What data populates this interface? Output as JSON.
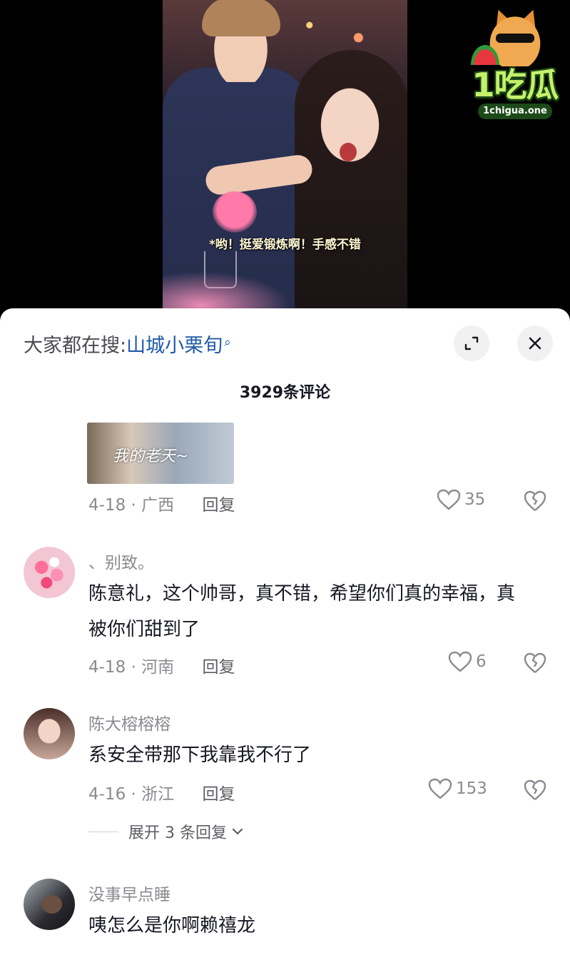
{
  "video": {
    "subtitle": "*哟！挺爱锻炼啊！手感不错"
  },
  "watermark": {
    "logo_text": "1吃瓜",
    "domain": "1chigua.one"
  },
  "search": {
    "prefix": "大家都在搜:",
    "term": "山城小栗旬"
  },
  "comments_header": {
    "count_label": "3929条评论"
  },
  "comments": [
    {
      "image_caption": "我的老天~",
      "date_location": "4-18 · 广西",
      "reply_label": "回复",
      "likes": "35"
    },
    {
      "username": "、别致。",
      "text": "陈意礼，这个帅哥，真不错，希望你们真的幸福，真被你们甜到了",
      "date_location": "4-18 · 河南",
      "reply_label": "回复",
      "likes": "6"
    },
    {
      "username": "陈大榕榕榕",
      "text": "系安全带那下我靠我不行了",
      "date_location": "4-16 · 浙江",
      "reply_label": "回复",
      "likes": "153",
      "expand_label": "展开 3 条回复"
    },
    {
      "username": "没事早点睡",
      "text": "咦怎么是你啊赖禧龙"
    }
  ],
  "colors": {
    "search_link": "#1e5aa8",
    "secondary_text": "#8a8b91",
    "primary_text": "#161823"
  }
}
